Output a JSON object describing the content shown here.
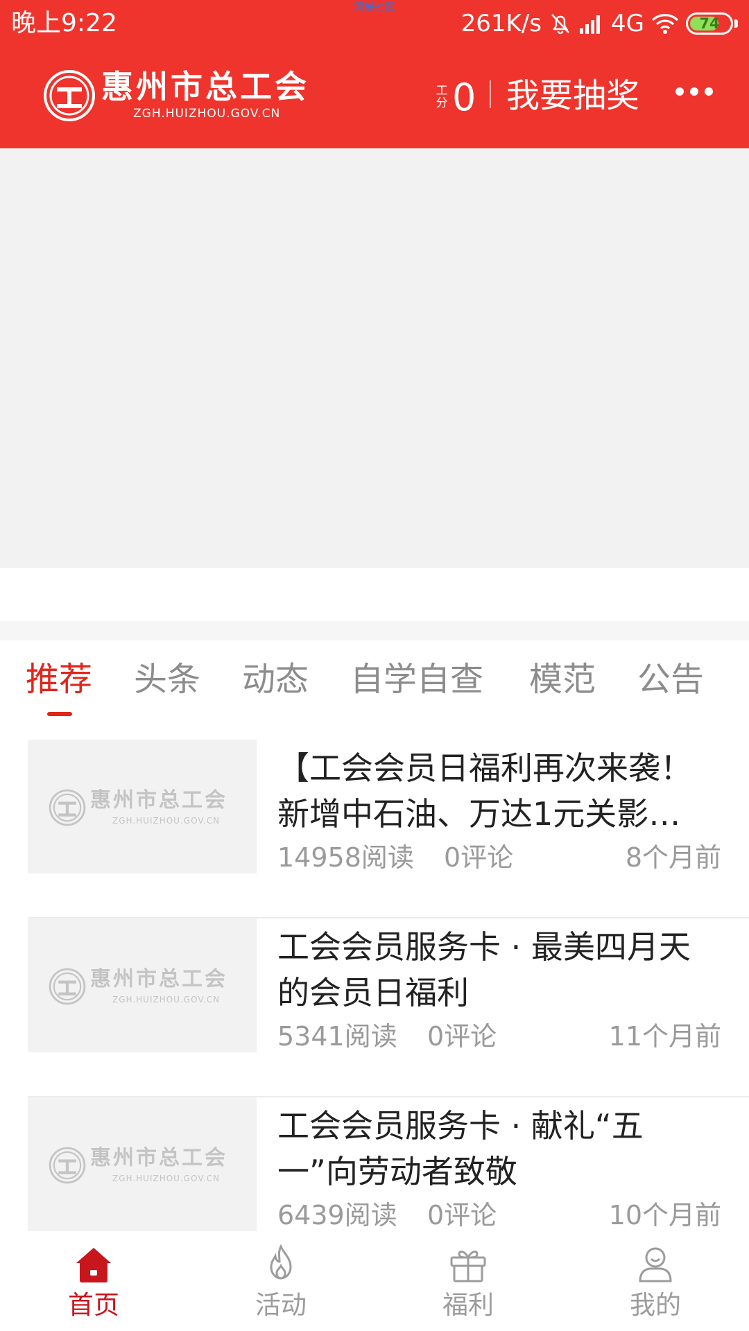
{
  "status_bar": {
    "time": "晚上9:22",
    "watermark": "流星社区",
    "net_speed": "261K/s",
    "network": "4G",
    "battery": "74",
    "battery_level": 0.74,
    "accent_color": "#ee342c"
  },
  "header": {
    "logo_name": "惠州市总工会",
    "logo_url": "ZGH.HUIZHOU.GOV.CN",
    "points_label": "工分",
    "points_value": "0",
    "lottery_label": "我要抽奖",
    "more_icon": "more-dots-icon"
  },
  "tabs": [
    {
      "label": "推荐",
      "active": true
    },
    {
      "label": "头条",
      "active": false
    },
    {
      "label": "动态",
      "active": false
    },
    {
      "label": "自学自查",
      "active": false
    },
    {
      "label": "模范",
      "active": false
    },
    {
      "label": "公告",
      "active": false
    }
  ],
  "articles": [
    {
      "title": "【工会会员日福利再次来袭！新增中石油、万达1元关影…",
      "reads": "14958阅读",
      "comments": "0评论",
      "time": "8个月前"
    },
    {
      "title": "工会会员服务卡 · 最美四月天的会员日福利",
      "reads": "5341阅读",
      "comments": "0评论",
      "time": "11个月前"
    },
    {
      "title": "工会会员服务卡 · 献礼“五一”向劳动者致敬",
      "reads": "6439阅读",
      "comments": "0评论",
      "time": "10个月前"
    }
  ],
  "thumbnail": {
    "logo_name": "惠州市总工会",
    "logo_url": "ZGH.HUIZHOU.GOV.CN"
  },
  "bottom_nav": [
    {
      "label": "首页",
      "icon": "home-icon",
      "active": true
    },
    {
      "label": "活动",
      "icon": "flame-icon",
      "active": false
    },
    {
      "label": "福利",
      "icon": "gift-icon",
      "active": false
    },
    {
      "label": "我的",
      "icon": "profile-icon",
      "active": false
    }
  ]
}
